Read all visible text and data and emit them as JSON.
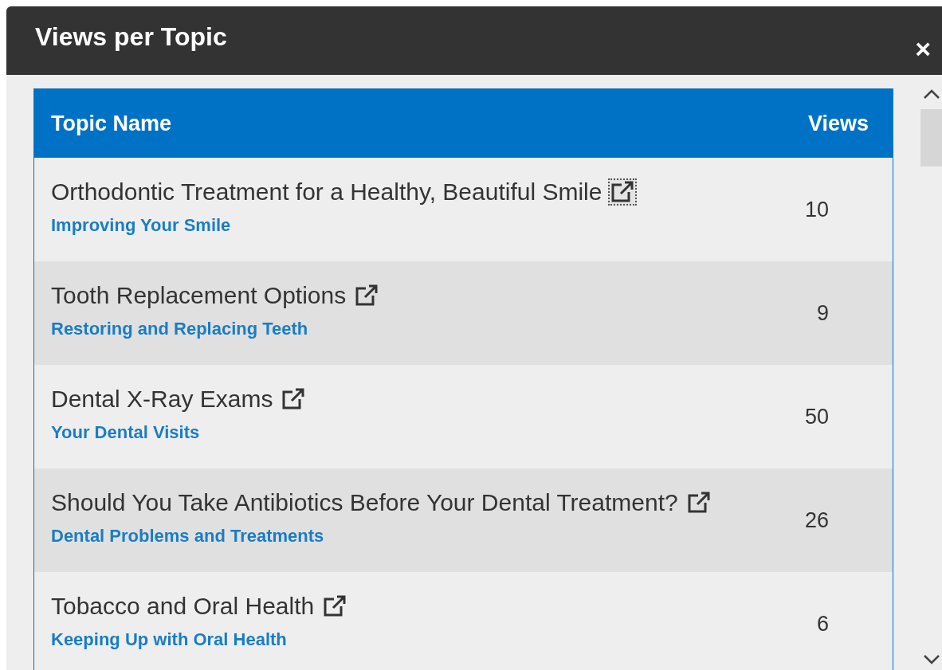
{
  "dialog": {
    "title": "Views per Topic",
    "close": "×"
  },
  "table": {
    "columns": [
      "Topic Name",
      "Views"
    ],
    "rows": [
      {
        "title": "Orthodontic Treatment for a Healthy, Beautiful Smile",
        "category": "Improving Your Smile",
        "views": "10",
        "focused": true
      },
      {
        "title": "Tooth Replacement Options",
        "category": "Restoring and Replacing Teeth",
        "views": "9",
        "focused": false
      },
      {
        "title": "Dental X-Ray Exams",
        "category": "Your Dental Visits",
        "views": "50",
        "focused": false
      },
      {
        "title": "Should You Take Antibiotics Before Your Dental Treatment?",
        "category": "Dental Problems and Treatments",
        "views": "26",
        "focused": false
      },
      {
        "title": "Tobacco and Oral Health",
        "category": "Keeping Up with Oral Health",
        "views": "6",
        "focused": false
      }
    ]
  }
}
